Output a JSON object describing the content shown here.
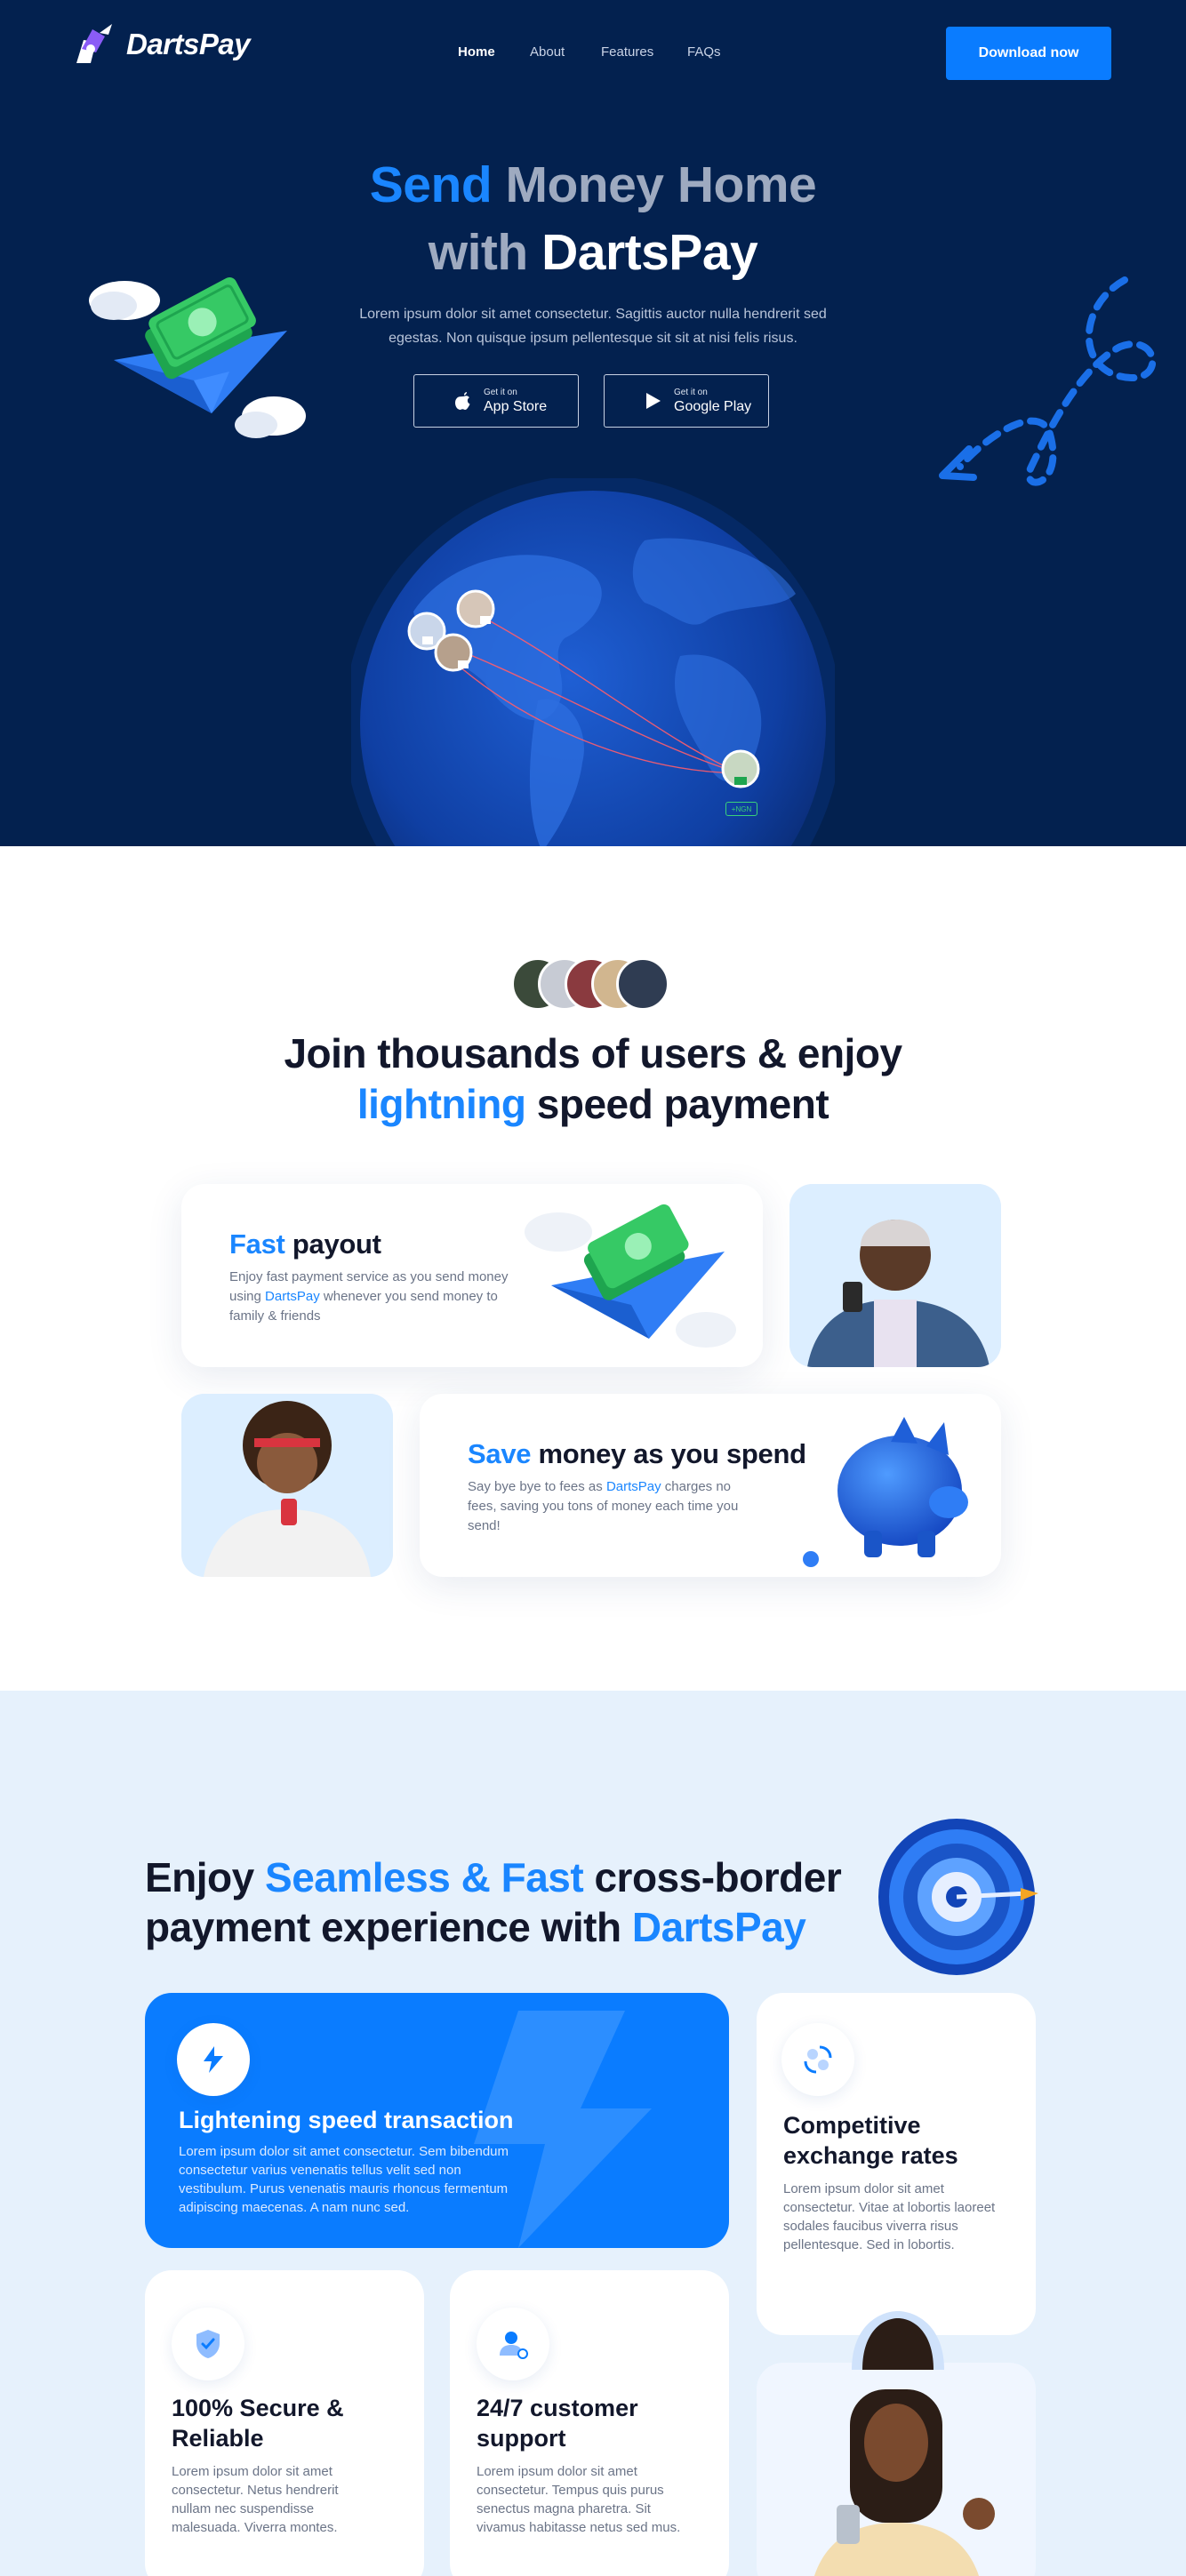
{
  "brand": {
    "name": "DartsPay",
    "accent": "#0a7cff",
    "navy": "#03214f"
  },
  "nav": {
    "items": [
      "Home",
      "About",
      "Features",
      "FAQs"
    ],
    "active": "Home",
    "cta": "Download now"
  },
  "hero": {
    "title_line1_blue": "Send",
    "title_line1_grey": "Money Home",
    "title_line2_grey": "with",
    "title_line2_white": "DartsPay",
    "subtitle": "Lorem ipsum dolor sit amet consectetur. Sagittis auctor nulla hendrerit sed egestas. Non quisque ipsum pellentesque sit sit at nisi felis risus.",
    "app_store": {
      "small": "Get it on",
      "big": "App Store",
      "icon": "apple-icon"
    },
    "google_play": {
      "small": "Get it on",
      "big": "Google Play",
      "icon": "play-icon"
    },
    "globe_badge": "+NGN"
  },
  "join": {
    "title_line1": "Join thousands of users & enjoy",
    "title_blue": "lightning",
    "title_rest": "speed payment",
    "fast": {
      "title_blue": "Fast",
      "title_rest": "payout",
      "text_before": "Enjoy fast payment service as you send money using",
      "brand": "DartsPay",
      "text_after": "whenever you send money to family & friends"
    },
    "save": {
      "title_blue": "Save",
      "title_rest": "money as you spend",
      "text_before": "Say bye bye to fees as",
      "brand": "DartsPay",
      "text_after": "charges no fees, saving you tons of money each time you send!"
    }
  },
  "features": {
    "title_a": "Enjoy",
    "title_blue1": "Seamless & Fast",
    "title_b": "cross-border",
    "title_c": "payment experience with",
    "title_blue2": "DartsPay",
    "cards": {
      "speed": {
        "title": "Lightening speed transaction",
        "text": "Lorem ipsum dolor sit amet consectetur. Sem bibendum consectetur varius venenatis tellus velit sed non vestibulum. Purus venenatis mauris rhoncus fermentum adipiscing maecenas. A nam nunc sed.",
        "icon": "bolt-icon"
      },
      "rates": {
        "title": "Competitive exchange rates",
        "text": "Lorem ipsum dolor sit amet consectetur. Vitae at lobortis laoreet sodales faucibus viverra risus pellentesque. Sed in lobortis.",
        "icon": "exchange-icon"
      },
      "secure": {
        "title": "100% Secure & Reliable",
        "text": "Lorem ipsum dolor sit amet consectetur. Netus hendrerit nullam nec suspendisse malesuada. Viverra montes.",
        "icon": "shield-icon"
      },
      "support": {
        "title": "24/7 customer support",
        "text": "Lorem ipsum dolor sit amet consectetur. Tempus quis purus senectus magna pharetra. Sit vivamus habitasse netus sed mus.",
        "icon": "support-agent-icon"
      }
    }
  }
}
